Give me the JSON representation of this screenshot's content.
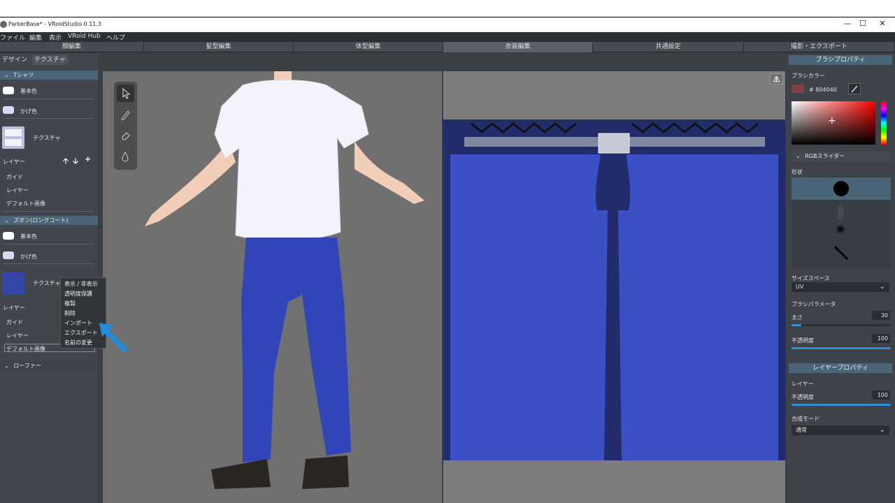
{
  "window": {
    "title": "ParkerBase* - VRoidStudio 0.11.3",
    "minimize": "—",
    "maximize": "☐",
    "close": "✕"
  },
  "menu": [
    "ファイル",
    "編集",
    "表示",
    "VRoid Hub",
    "ヘルプ"
  ],
  "mode_tabs": [
    "顔編集",
    "髪型編集",
    "体型編集",
    "衣装編集",
    "共通設定",
    "撮影・エクスポート"
  ],
  "active_mode_tab": "衣装編集",
  "left_panel": {
    "tabs": [
      "デザイン",
      "テクスチャ"
    ],
    "active_tab": "テクスチャ",
    "sections": [
      {
        "title": "Tシャツ",
        "items": [
          {
            "label": "基本色",
            "color": "#ffffff"
          },
          {
            "label": "かげ色",
            "color": "#d7d9f3"
          },
          {
            "label": "テクスチャ"
          }
        ],
        "layer_label": "レイヤー",
        "layer_buttons": [
          "🡡",
          "🡣",
          "+"
        ],
        "layers": [
          "ガイド",
          "レイヤー",
          "デフォルト画像"
        ]
      },
      {
        "title": "ズボン(ロングコート)",
        "items": [
          {
            "label": "基本色",
            "color": "#ffffff"
          },
          {
            "label": "かげ色",
            "color": "#d7d9f3"
          },
          {
            "label": "テクスチャ"
          }
        ],
        "layer_label": "レイヤー",
        "layers": [
          "ガイド",
          "レイヤー",
          "デフォルト画像"
        ]
      },
      {
        "title": "ローファー"
      }
    ]
  },
  "context_menu": [
    "表示 / 非表示",
    "透明度保護",
    "複製",
    "削除",
    "インポート",
    "エクスポート",
    "名前の変更"
  ],
  "right_panel": {
    "brush_header": "ブラシプロパティ",
    "brush_color_label": "ブラシカラー",
    "brush_color_hex": "# 804040",
    "brush_color": "#804040",
    "rgb_slider_label": "RGBスライダー",
    "shape_label": "形状",
    "size_space_label": "サイズスペース",
    "size_space_value": "UV",
    "brush_param_label": "ブラシパラメータ",
    "thickness_label": "太さ",
    "thickness_value": "30",
    "thickness_fraction": 0.1,
    "opacity_label": "不透明度",
    "opacity_value": "100",
    "opacity_fraction": 1.0,
    "layer_header": "レイヤープロパティ",
    "layer_label": "レイヤー",
    "layer_opacity_label": "不透明度",
    "layer_opacity_value": "100",
    "layer_opacity_fraction": 1.0,
    "blend_mode_label": "合成モード",
    "blend_mode_value": "通常"
  }
}
